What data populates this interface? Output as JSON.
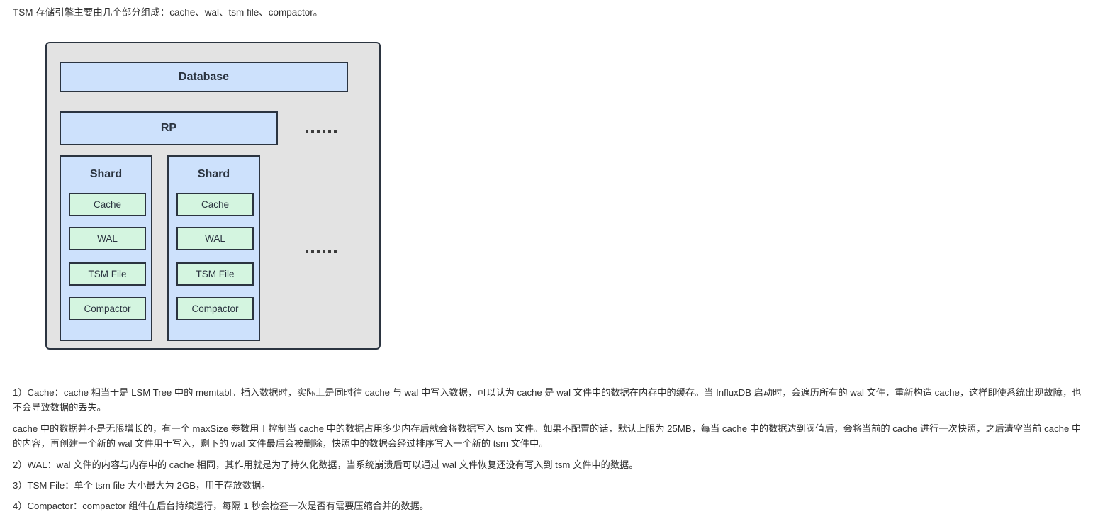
{
  "top_sliver": "……………………",
  "intro": "TSM 存储引擎主要由几个部分组成：cache、wal、tsm file、compactor。",
  "diagram": {
    "database_label": "Database",
    "rp_label": "RP",
    "shards": [
      {
        "title": "Shard",
        "items": [
          "Cache",
          "WAL",
          "TSM File",
          "Compactor"
        ]
      },
      {
        "title": "Shard",
        "items": [
          "Cache",
          "WAL",
          "TSM File",
          "Compactor"
        ]
      }
    ],
    "ellipsis_rp": "······",
    "ellipsis_shard": "······",
    "colors": {
      "container_fill": "#e3e3e3",
      "border": "#2b3440",
      "blue_fill": "#cde1fc",
      "green_fill": "#d4f5e0"
    }
  },
  "paragraphs": [
    "1）Cache：cache 相当于是 LSM Tree 中的 memtabl。插入数据时，实际上是同时往 cache 与 wal 中写入数据，可以认为 cache 是 wal 文件中的数据在内存中的缓存。当 InfluxDB 启动时，会遍历所有的 wal 文件，重新构造 cache，这样即使系统出现故障，也不会导致数据的丢失。",
    "cache 中的数据并不是无限增长的，有一个 maxSize 参数用于控制当 cache 中的数据占用多少内存后就会将数据写入 tsm 文件。如果不配置的话，默认上限为 25MB，每当 cache 中的数据达到阀值后，会将当前的 cache 进行一次快照，之后清空当前 cache 中的内容，再创建一个新的 wal 文件用于写入，剩下的 wal 文件最后会被删除，快照中的数据会经过排序写入一个新的 tsm 文件中。",
    "2）WAL：wal 文件的内容与内存中的 cache 相同，其作用就是为了持久化数据，当系统崩溃后可以通过 wal 文件恢复还没有写入到 tsm 文件中的数据。",
    "3）TSM File：单个 tsm file 大小最大为 2GB，用于存放数据。",
    "4）Compactor：compactor 组件在后台持续运行，每隔 1 秒会检查一次是否有需要压缩合并的数据。"
  ]
}
